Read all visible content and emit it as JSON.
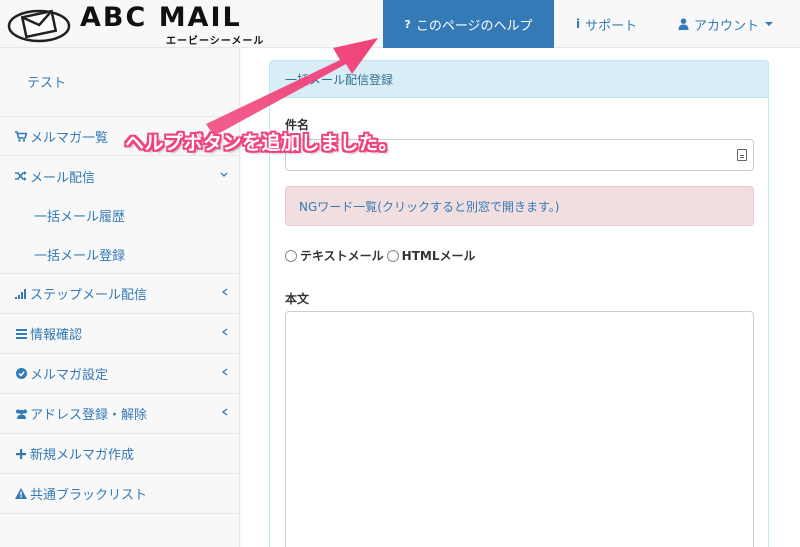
{
  "header": {
    "brand": "ABC MAIL",
    "brand_sub": "エービーシーメール",
    "help_button": "このページのヘルプ",
    "help_icon": "?",
    "support": "サポート",
    "support_icon": "i",
    "account": "アカウント"
  },
  "sidebar": {
    "top_link": "テスト",
    "items": [
      {
        "label": "メルマガ一覧",
        "icon": "cart-icon"
      },
      {
        "label": "メール配信",
        "icon": "shuffle-icon",
        "expanded": true
      },
      {
        "label": "ステップメール配信",
        "icon": "signal-icon"
      },
      {
        "label": "情報確認",
        "icon": "list-icon"
      },
      {
        "label": "メルマガ設定",
        "icon": "check-circle-icon"
      },
      {
        "label": "アドレス登録・解除",
        "icon": "users-icon"
      },
      {
        "label": "新規メルマガ作成",
        "icon": "plus-icon"
      },
      {
        "label": "共通ブラックリスト",
        "icon": "warning-icon"
      }
    ],
    "subitems": [
      "一括メール履歴",
      "一括メール登録"
    ]
  },
  "panel": {
    "heading": "一括メール配信登録",
    "subject_label": "件名",
    "subject_value": "",
    "ng_words": "NGワード一覧(クリックすると別窓で開きます。)",
    "radio_text": "テキストメール",
    "radio_html": "HTMLメール",
    "body_label": "本文"
  },
  "annotation": {
    "text": "ヘルプボタンを追加しました。",
    "color": "#f0437a"
  },
  "colors": {
    "accent": "#337ab7",
    "panel_heading_bg": "#d9edf7",
    "alert_bg": "#f2dede"
  }
}
